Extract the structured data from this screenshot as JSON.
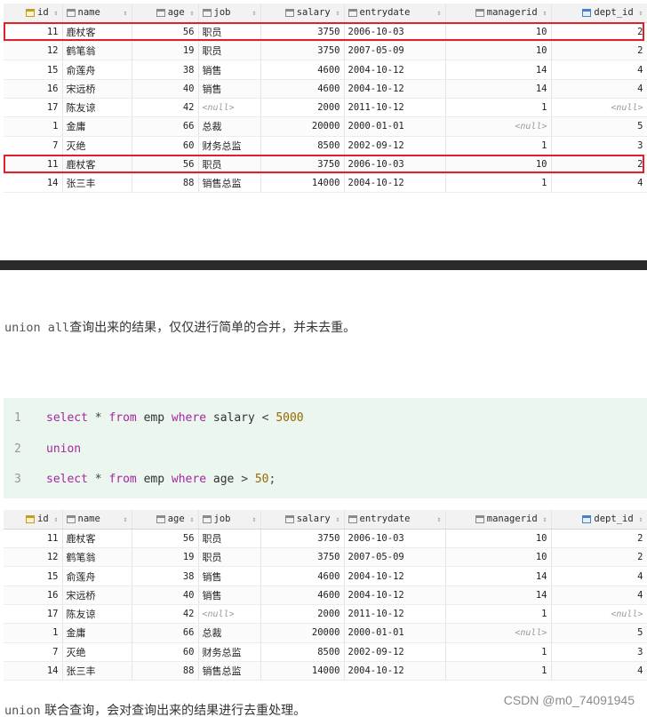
{
  "columns": [
    {
      "name": "id",
      "icon": "key-column-icon",
      "align": "right"
    },
    {
      "name": "name",
      "icon": "column-icon",
      "align": "left"
    },
    {
      "name": "age",
      "icon": "column-icon",
      "align": "right"
    },
    {
      "name": "job",
      "icon": "column-icon",
      "align": "left"
    },
    {
      "name": "salary",
      "icon": "column-icon",
      "align": "right"
    },
    {
      "name": "entrydate",
      "icon": "column-icon",
      "align": "left"
    },
    {
      "name": "managerid",
      "icon": "column-icon",
      "align": "right"
    },
    {
      "name": "dept_id",
      "icon": "foreign-key-column-icon",
      "align": "right"
    }
  ],
  "null_text": "<null>",
  "sort_glyph": "⇕",
  "top_table": {
    "rows": [
      [
        "11",
        "鹿杖客",
        "56",
        "职员",
        "3750",
        "2006-10-03",
        "10",
        "2"
      ],
      [
        "12",
        "鹤笔翁",
        "19",
        "职员",
        "3750",
        "2007-05-09",
        "10",
        "2"
      ],
      [
        "15",
        "俞莲舟",
        "38",
        "销售",
        "4600",
        "2004-10-12",
        "14",
        "4"
      ],
      [
        "16",
        "宋远桥",
        "40",
        "销售",
        "4600",
        "2004-10-12",
        "14",
        "4"
      ],
      [
        "17",
        "陈友谅",
        "42",
        "<null>",
        "2000",
        "2011-10-12",
        "1",
        "<null>"
      ],
      [
        "1",
        "金庸",
        "66",
        "总裁",
        "20000",
        "2000-01-01",
        "<null>",
        "5"
      ],
      [
        "7",
        "灭绝",
        "60",
        "财务总监",
        "8500",
        "2002-09-12",
        "1",
        "3"
      ],
      [
        "11",
        "鹿杖客",
        "56",
        "职员",
        "3750",
        "2006-10-03",
        "10",
        "2"
      ],
      [
        "14",
        "张三丰",
        "88",
        "销售总监",
        "14000",
        "2004-10-12",
        "1",
        "4"
      ]
    ],
    "highlighted_rows": [
      0,
      7
    ]
  },
  "note_union_all": {
    "code": "union all",
    "text": "查询出来的结果，仅仅进行简单的合并，并未去重。"
  },
  "code_block": {
    "lines": [
      {
        "num": "1",
        "parts": [
          [
            "kw",
            "select"
          ],
          [
            "op",
            " * "
          ],
          [
            "kw",
            "from"
          ],
          [
            "txt",
            " emp "
          ],
          [
            "kw",
            "where"
          ],
          [
            "txt",
            " salary "
          ],
          [
            "op",
            "< "
          ],
          [
            "num",
            "5000"
          ]
        ]
      },
      {
        "num": "2",
        "parts": [
          [
            "kw",
            "union"
          ]
        ]
      },
      {
        "num": "3",
        "parts": [
          [
            "kw",
            "select"
          ],
          [
            "op",
            " * "
          ],
          [
            "kw",
            "from"
          ],
          [
            "txt",
            " emp "
          ],
          [
            "kw",
            "where"
          ],
          [
            "txt",
            " age "
          ],
          [
            "op",
            "> "
          ],
          [
            "num",
            "50"
          ],
          [
            "op",
            ";"
          ]
        ]
      }
    ]
  },
  "bottom_table": {
    "rows": [
      [
        "11",
        "鹿杖客",
        "56",
        "职员",
        "3750",
        "2006-10-03",
        "10",
        "2"
      ],
      [
        "12",
        "鹤笔翁",
        "19",
        "职员",
        "3750",
        "2007-05-09",
        "10",
        "2"
      ],
      [
        "15",
        "俞莲舟",
        "38",
        "销售",
        "4600",
        "2004-10-12",
        "14",
        "4"
      ],
      [
        "16",
        "宋远桥",
        "40",
        "销售",
        "4600",
        "2004-10-12",
        "14",
        "4"
      ],
      [
        "17",
        "陈友谅",
        "42",
        "<null>",
        "2000",
        "2011-10-12",
        "1",
        "<null>"
      ],
      [
        "1",
        "金庸",
        "66",
        "总裁",
        "20000",
        "2000-01-01",
        "<null>",
        "5"
      ],
      [
        "7",
        "灭绝",
        "60",
        "财务总监",
        "8500",
        "2002-09-12",
        "1",
        "3"
      ],
      [
        "14",
        "张三丰",
        "88",
        "销售总监",
        "14000",
        "2004-10-12",
        "1",
        "4"
      ]
    ]
  },
  "note_union": {
    "code": "union",
    "text": " 联合查询，会对查询出来的结果进行去重处理。"
  },
  "watermark": "CSDN @m0_74091945",
  "colors": {
    "highlight": "#e0202a",
    "code_bg": "#eaf6ee",
    "keyword": "#a626a4",
    "number": "#986801",
    "divider": "#2b2b2b"
  }
}
